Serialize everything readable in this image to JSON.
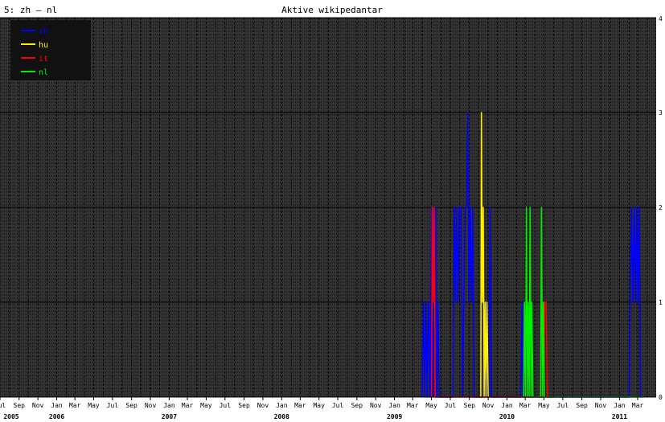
{
  "header": {
    "left_label": "5: zh – nl",
    "title": "Aktive wikipedantar"
  },
  "colors": {
    "background": "#ffffff",
    "plot_bg": "#333333",
    "grid_minor": "#000000",
    "grid_major": "#000000",
    "legend_bg": "#111111",
    "text": "#000000",
    "zh": "#0000ff",
    "hu": "#ffee00",
    "it": "#ff0000",
    "nl": "#00ee00"
  },
  "chart_data": {
    "type": "line",
    "title": "Aktive wikipedantar",
    "ylim": [
      0,
      4
    ],
    "y_ticks": [
      0,
      1,
      2,
      3,
      4
    ],
    "x_range": [
      "2005-07-01",
      "2011-04-30"
    ],
    "grid": true,
    "legend_position": "top-left",
    "x_month_labels": [
      "Jul",
      "Sep",
      "Nov",
      "Jan",
      "Mar",
      "May",
      "Jul",
      "Sep",
      "Nov",
      "Jan",
      "Mar",
      "May",
      "Jul",
      "Sep",
      "Nov",
      "Jan",
      "Mar",
      "May",
      "Jul",
      "Sep",
      "Nov",
      "Jan",
      "Mar",
      "May",
      "Jul",
      "Sep",
      "Nov",
      "Jan",
      "Mar",
      "May",
      "Jul",
      "Sep",
      "Nov",
      "Jan",
      "Mar",
      "May",
      "Jul",
      "Sep",
      "Nov",
      "Jan",
      "Mar"
    ],
    "x_month_label_dates": [
      "2005-07",
      "2005-09",
      "2005-11",
      "2006-01",
      "2006-03",
      "2006-05",
      "2006-07",
      "2006-09",
      "2006-11",
      "2007-01",
      "2007-03",
      "2007-05",
      "2007-07",
      "2007-09",
      "2007-11",
      "2008-01",
      "2008-03",
      "2008-05",
      "2008-07",
      "2008-09",
      "2008-11",
      "2009-01",
      "2009-03",
      "2009-05",
      "2009-07",
      "2009-09",
      "2009-11",
      "2010-01",
      "2010-03",
      "2010-05",
      "2010-07",
      "2010-09",
      "2010-11",
      "2011-01",
      "2011-03"
    ],
    "x_year_labels": [
      {
        "label": "2005",
        "date": "2005-07"
      },
      {
        "label": "2006",
        "date": "2006-01"
      },
      {
        "label": "2007",
        "date": "2007-01"
      },
      {
        "label": "2008",
        "date": "2008-01"
      },
      {
        "label": "2009",
        "date": "2009-01"
      },
      {
        "label": "2010",
        "date": "2010-01"
      },
      {
        "label": "2011",
        "date": "2011-01"
      }
    ],
    "series": [
      {
        "name": "zh",
        "color": "#0000ff",
        "points": [
          [
            "2009-04-01",
            0
          ],
          [
            "2009-04-05",
            1
          ],
          [
            "2009-04-09",
            0
          ],
          [
            "2009-04-13",
            1
          ],
          [
            "2009-04-17",
            0
          ],
          [
            "2009-04-22",
            1
          ],
          [
            "2009-04-27",
            0
          ],
          [
            "2009-05-01",
            2
          ],
          [
            "2009-05-05",
            0
          ],
          [
            "2009-05-10",
            1
          ],
          [
            "2009-05-15",
            2
          ],
          [
            "2009-05-18",
            0
          ],
          [
            "2009-05-22",
            1
          ],
          [
            "2009-05-26",
            0
          ],
          [
            "2009-07-10",
            0
          ],
          [
            "2009-07-14",
            2
          ],
          [
            "2009-07-18",
            1
          ],
          [
            "2009-07-22",
            2
          ],
          [
            "2009-07-26",
            1
          ],
          [
            "2009-07-30",
            2
          ],
          [
            "2009-08-05",
            2
          ],
          [
            "2009-08-10",
            0
          ],
          [
            "2009-08-14",
            1
          ],
          [
            "2009-08-18",
            2
          ],
          [
            "2009-08-23",
            2
          ],
          [
            "2009-08-27",
            3
          ],
          [
            "2009-08-31",
            1
          ],
          [
            "2009-09-04",
            2
          ],
          [
            "2009-09-08",
            1
          ],
          [
            "2009-09-12",
            2
          ],
          [
            "2009-09-16",
            0
          ],
          [
            "2009-10-01",
            0
          ],
          [
            "2009-10-20",
            0
          ],
          [
            "2009-10-24",
            1
          ],
          [
            "2009-10-28",
            0
          ],
          [
            "2009-11-03",
            0
          ],
          [
            "2009-11-07",
            2
          ],
          [
            "2009-11-11",
            0
          ],
          [
            "2010-02-15",
            0
          ],
          [
            "2010-02-19",
            1
          ],
          [
            "2010-02-23",
            0
          ],
          [
            "2011-02-01",
            0
          ],
          [
            "2011-02-05",
            1
          ],
          [
            "2011-02-09",
            2
          ],
          [
            "2011-02-13",
            1
          ],
          [
            "2011-02-18",
            2
          ],
          [
            "2011-02-22",
            1
          ],
          [
            "2011-02-26",
            2
          ],
          [
            "2011-03-02",
            1
          ],
          [
            "2011-03-06",
            2
          ],
          [
            "2011-03-10",
            0
          ]
        ]
      },
      {
        "name": "hu",
        "color": "#ffee00",
        "points": [
          [
            "2009-10-08",
            0
          ],
          [
            "2009-10-10",
            3
          ],
          [
            "2009-10-13",
            1
          ],
          [
            "2009-10-16",
            2
          ],
          [
            "2009-10-19",
            0
          ],
          [
            "2009-10-22",
            1
          ],
          [
            "2009-10-25",
            0
          ],
          [
            "2009-10-28",
            1
          ],
          [
            "2009-11-01",
            0
          ]
        ]
      },
      {
        "name": "it",
        "color": "#ff0000",
        "points": [
          [
            "2009-05-01",
            0
          ],
          [
            "2009-05-04",
            2
          ],
          [
            "2009-05-07",
            1
          ],
          [
            "2009-05-10",
            2
          ],
          [
            "2009-05-13",
            0
          ],
          [
            "2009-06-01",
            0
          ],
          [
            "2010-05-01",
            0
          ],
          [
            "2010-05-03",
            1
          ],
          [
            "2010-05-08",
            1
          ],
          [
            "2010-05-12",
            0
          ],
          [
            "2010-06-01",
            0
          ]
        ]
      },
      {
        "name": "nl",
        "color": "#00ee00",
        "points": [
          [
            "2010-02-24",
            0
          ],
          [
            "2010-02-27",
            1
          ],
          [
            "2010-03-02",
            0
          ],
          [
            "2010-03-05",
            2
          ],
          [
            "2010-03-08",
            0
          ],
          [
            "2010-03-11",
            1
          ],
          [
            "2010-03-14",
            0
          ],
          [
            "2010-03-17",
            2
          ],
          [
            "2010-03-20",
            0
          ],
          [
            "2010-03-23",
            1
          ],
          [
            "2010-03-26",
            0
          ],
          [
            "2010-04-20",
            0
          ],
          [
            "2010-04-23",
            2
          ],
          [
            "2010-04-26",
            0
          ],
          [
            "2010-04-29",
            1
          ],
          [
            "2010-05-02",
            0
          ],
          [
            "2011-03-20",
            0
          ]
        ]
      }
    ]
  }
}
